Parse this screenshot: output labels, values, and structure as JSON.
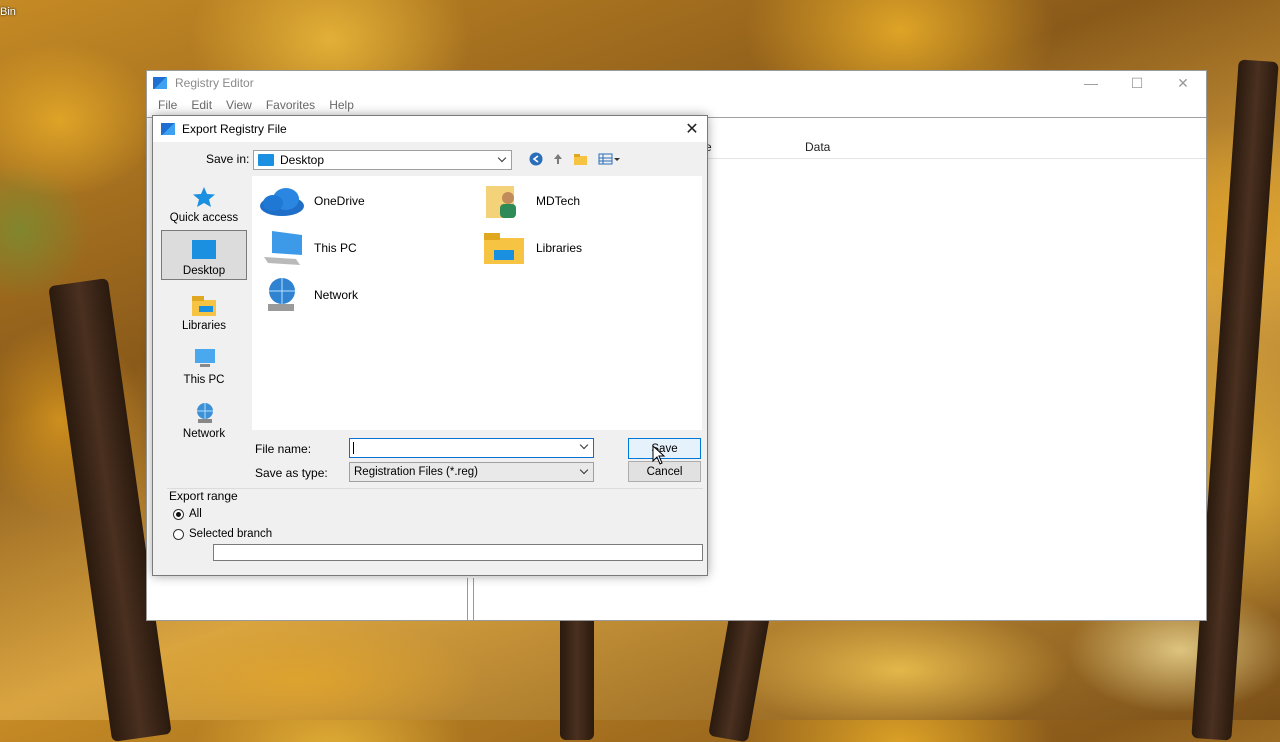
{
  "desktop": {
    "corner_label": "Bin"
  },
  "registry_window": {
    "title": "Registry Editor",
    "menu": [
      "File",
      "Edit",
      "View",
      "Favorites",
      "Help"
    ],
    "column_fragment": "e",
    "column_data": "Data",
    "controls": {
      "minimize": "—",
      "maximize": "☐",
      "close": "✕"
    }
  },
  "dialog": {
    "title": "Export Registry File",
    "close_glyph": "✕",
    "save_in_label": "Save in:",
    "save_in_value": "Desktop",
    "places": [
      {
        "label": "Quick access"
      },
      {
        "label": "Desktop"
      },
      {
        "label": "Libraries"
      },
      {
        "label": "This PC"
      },
      {
        "label": "Network"
      }
    ],
    "items": [
      {
        "label": "OneDrive"
      },
      {
        "label": "MDTech"
      },
      {
        "label": "This PC"
      },
      {
        "label": "Libraries"
      },
      {
        "label": "Network"
      }
    ],
    "file_name_label": "File name:",
    "file_name_value": "",
    "save_as_type_label": "Save as type:",
    "save_as_type_value": "Registration Files (*.reg)",
    "save_button": "Save",
    "cancel_button": "Cancel",
    "export_range_label": "Export range",
    "range_all": "All",
    "range_selected": "Selected branch",
    "selected_range": "All"
  },
  "colors": {
    "accent": "#0078d7",
    "folder_blue": "#1b8fe0",
    "folder_yellow": "#f6c342"
  }
}
